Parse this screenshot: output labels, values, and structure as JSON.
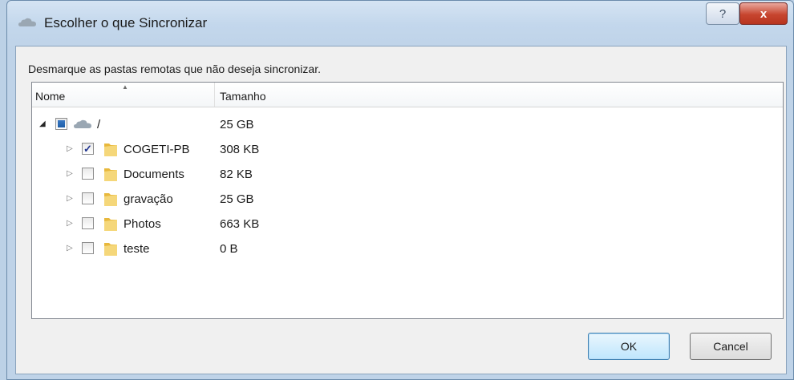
{
  "window": {
    "title": "Escolher o que Sincronizar",
    "help_label": "?",
    "close_label": "x"
  },
  "instruction": "Desmarque as pastas remotas que não deseja sincronizar.",
  "columns": {
    "name": "Nome",
    "size": "Tamanho"
  },
  "root": {
    "name": "/",
    "size": "25 GB",
    "check_state": "indeterminate"
  },
  "folders": [
    {
      "name": "COGETI-PB",
      "size": "308 KB",
      "checked": true
    },
    {
      "name": "Documents",
      "size": "82 KB",
      "checked": false
    },
    {
      "name": "gravação",
      "size": "25 GB",
      "checked": false
    },
    {
      "name": "Photos",
      "size": "663 KB",
      "checked": false
    },
    {
      "name": "teste",
      "size": "0 B",
      "checked": false
    }
  ],
  "buttons": {
    "ok": "OK",
    "cancel": "Cancel"
  },
  "icons": {
    "app": "cloud-icon",
    "root": "cloud-icon",
    "folder": "folder-icon",
    "expander_open": "triangle-down-icon",
    "expander_closed": "triangle-right-icon",
    "sort": "sort-up-icon"
  },
  "colors": {
    "folder": "#e8b83c",
    "cloud": "#9aa7b3",
    "close_button": "#c7452f",
    "check_mark": "#20348f"
  }
}
